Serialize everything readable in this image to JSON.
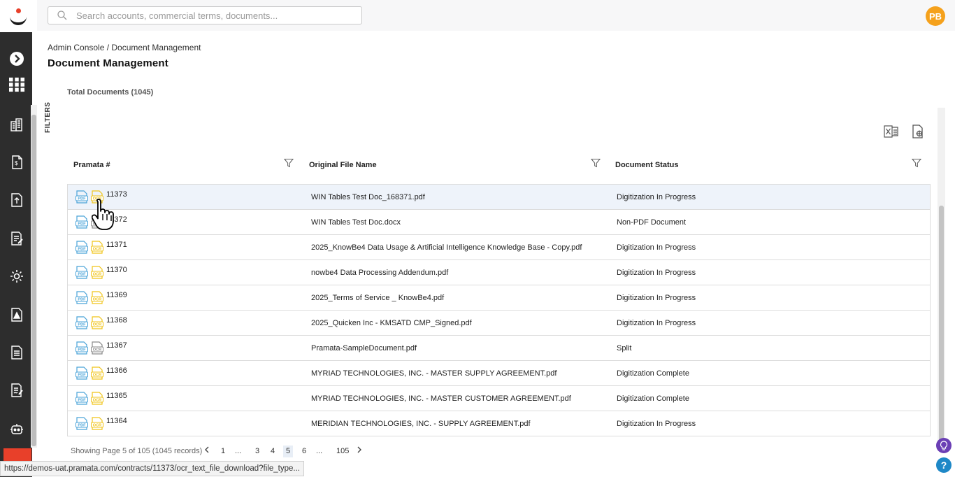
{
  "header": {
    "search_placeholder": "Search accounts, commercial terms, documents...",
    "avatar_initials": "PB"
  },
  "breadcrumb": "Admin Console / Document Management",
  "page_title": "Document Management",
  "total_documents": "Total Documents (1045)",
  "filters_label": "FILTERS",
  "columns": {
    "pramata": "Pramata #",
    "file_name": "Original File Name",
    "status": "Document Status"
  },
  "rows": [
    {
      "id": "11373",
      "file_name": "WIN Tables Test Doc_168371.pdf",
      "status": "Digitization In Progress",
      "ocr": "yellow"
    },
    {
      "id": "11372",
      "file_name": "WIN Tables Test Doc.docx",
      "status": "Non-PDF Document",
      "ocr": "gray"
    },
    {
      "id": "11371",
      "file_name": "2025_KnowBe4 Data Usage & Artificial Intelligence Knowledge Base - Copy.pdf",
      "status": "Digitization In Progress",
      "ocr": "yellow"
    },
    {
      "id": "11370",
      "file_name": "nowbe4 Data Processing Addendum.pdf",
      "status": "Digitization In Progress",
      "ocr": "yellow"
    },
    {
      "id": "11369",
      "file_name": "2025_Terms of Service _ KnowBe4.pdf",
      "status": "Digitization In Progress",
      "ocr": "yellow"
    },
    {
      "id": "11368",
      "file_name": "2025_Quicken Inc - KMSATD CMP_Signed.pdf",
      "status": "Digitization In Progress",
      "ocr": "yellow"
    },
    {
      "id": "11367",
      "file_name": "Pramata-SampleDocument.pdf",
      "status": "Split",
      "ocr": "gray"
    },
    {
      "id": "11366",
      "file_name": "MYRIAD TECHNOLOGIES, INC. - MASTER SUPPLY AGREEMENT.pdf",
      "status": "Digitization Complete",
      "ocr": "yellow"
    },
    {
      "id": "11365",
      "file_name": "MYRIAD TECHNOLOGIES, INC. - MASTER CUSTOMER AGREEMENT.pdf",
      "status": "Digitization Complete",
      "ocr": "yellow"
    },
    {
      "id": "11364",
      "file_name": "MERIDIAN TECHNOLOGIES, INC. - SUPPLY AGREEMENT.pdf",
      "status": "Digitization In Progress",
      "ocr": "yellow"
    }
  ],
  "pagination": {
    "info": "Showing Page 5 of 105 (1045 records)",
    "pages": [
      "1",
      "...",
      "3",
      "4",
      "5",
      "6",
      "...",
      "105"
    ],
    "current": "5"
  },
  "status_url": "https://demos-uat.pramata.com/contracts/11373/ocr_text_file_download?file_type...",
  "icon_labels": {
    "pdf": "PDF",
    "ocr": "OCR"
  },
  "help_label": "?",
  "colors": {
    "accent": "#e8402a",
    "avatar": "#f5a11c",
    "pdf_blue": "#4aa3d8",
    "ocr_yellow": "#f0c419",
    "ocr_gray": "#8a8a8a",
    "row_highlight": "#eef3fa"
  }
}
